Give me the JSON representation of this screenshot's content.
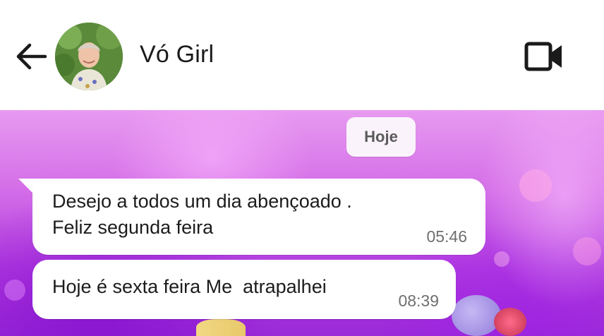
{
  "header": {
    "back_icon": "arrow-left-icon",
    "contact_name": "Vó Girl",
    "avatar_icon": "contact-avatar",
    "video_icon": "video-camera-icon"
  },
  "chat": {
    "date_separator": "Hoje",
    "messages": [
      {
        "text": "Desejo a todos um dia abençoado .\nFeliz segunda feira",
        "time": "05:46",
        "direction": "incoming"
      },
      {
        "text": "Hoje é sexta feira Me  atrapalhei",
        "time": "08:39",
        "direction": "incoming"
      }
    ]
  },
  "colors": {
    "header_bg": "#ffffff",
    "bubble_bg": "#ffffff",
    "wallpaper_accent": "#b13ce0"
  }
}
